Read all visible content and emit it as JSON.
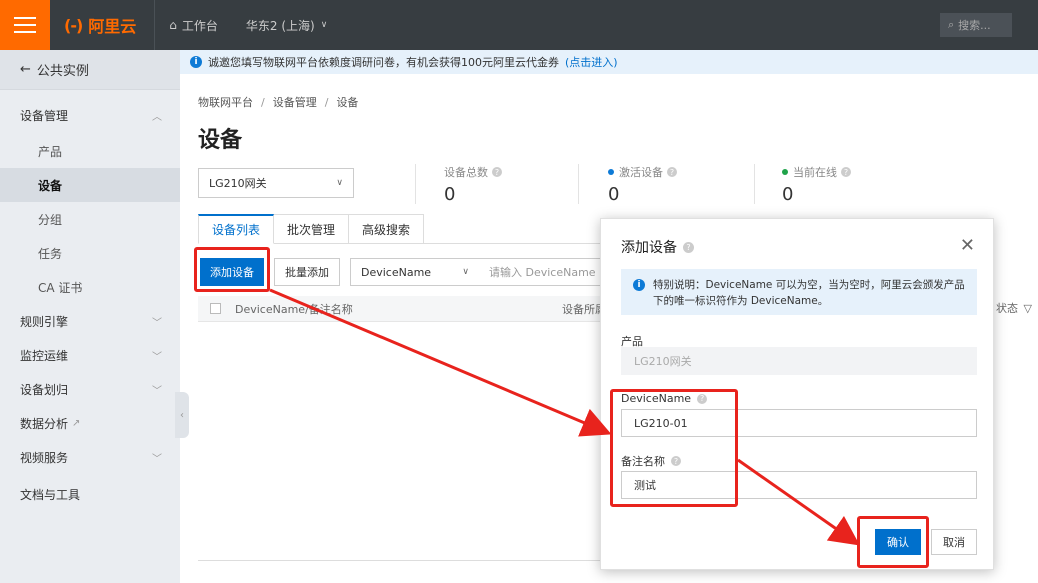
{
  "topbar": {
    "brand_mark": "(-)",
    "brand_text": "阿里云",
    "workbench": "工作台",
    "region": "华东2 (上海)",
    "search_placeholder": "搜索..."
  },
  "sidebar": {
    "back": "公共实例",
    "groups": [
      {
        "label": "设备管理",
        "chev": "^"
      },
      {
        "label": "规则引擎",
        "chev": "v"
      },
      {
        "label": "监控运维",
        "chev": "v"
      },
      {
        "label": "设备划归",
        "chev": "v"
      },
      {
        "label": "数据分析",
        "chev": ""
      },
      {
        "label": "视频服务",
        "chev": "v"
      },
      {
        "label": "文档与工具",
        "chev": ""
      }
    ],
    "sub_items": [
      "产品",
      "设备",
      "分组",
      "任务",
      "CA 证书"
    ]
  },
  "notice": {
    "text": "诚邀您填写物联网平台依赖度调研问卷，有机会获得100元阿里云代金券",
    "link": "(点击进入)"
  },
  "breadcrumb": [
    "物联网平台",
    "设备管理",
    "设备"
  ],
  "page_title": "设备",
  "product_select": "LG210网关",
  "stats": [
    {
      "label": "设备总数",
      "value": "0",
      "dot": ""
    },
    {
      "label": "激活设备",
      "value": "0",
      "dot": "#0d7ad6"
    },
    {
      "label": "当前在线",
      "value": "0",
      "dot": "#1fa34a"
    }
  ],
  "tabs": [
    "设备列表",
    "批次管理",
    "高级搜索"
  ],
  "toolbar": {
    "add_device": "添加设备",
    "batch_add": "批量添加",
    "filter_field": "DeviceName",
    "filter_placeholder": "请输入 DeviceName"
  },
  "table": {
    "col_name": "DeviceName/备注名称",
    "col_product": "设备所属",
    "col_status": "状态"
  },
  "modal": {
    "title": "添加设备",
    "tip": "特别说明：DeviceName 可以为空，当为空时，阿里云会颁发产品下的唯一标识符作为 DeviceName。",
    "product_label": "产品",
    "product_value": "LG210网关",
    "devicename_label": "DeviceName",
    "devicename_value": "LG210-01",
    "remark_label": "备注名称",
    "remark_value": "测试",
    "ok": "确认",
    "cancel": "取消"
  },
  "colors": {
    "accent": "#0070cc",
    "brand": "#ff6a00",
    "annotation": "#e8231d"
  }
}
